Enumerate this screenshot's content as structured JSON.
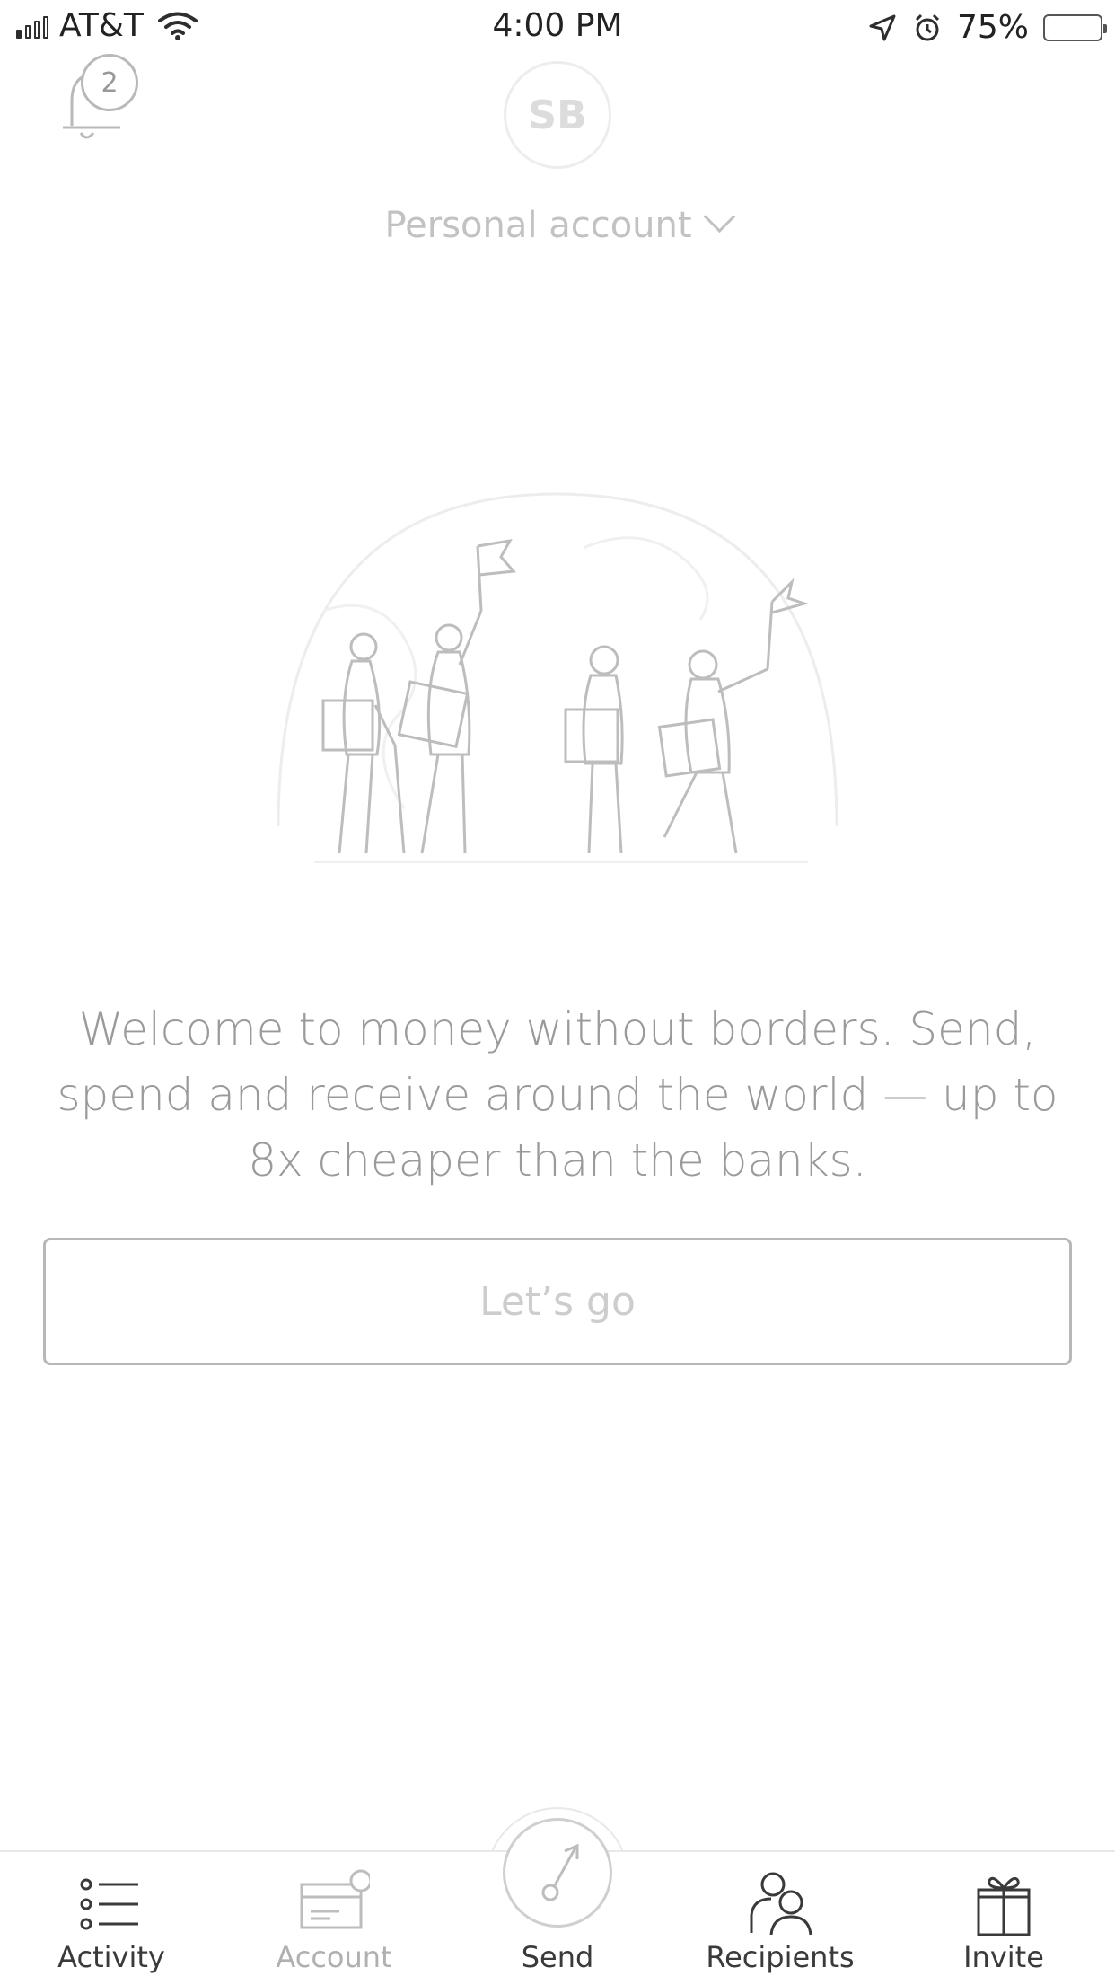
{
  "status_bar": {
    "carrier": "AT&T",
    "time": "4:00 PM",
    "battery_percent_label": "75%",
    "battery_level": 0.75
  },
  "header": {
    "notification_count": "2",
    "avatar_initials": "SB",
    "account_selector_label": "Personal account"
  },
  "welcome": {
    "message": "Welcome to money without borders. Send, spend and receive around the world — up to 8x cheaper than the banks.",
    "cta_label": "Let’s go"
  },
  "tabbar": {
    "tabs": [
      {
        "label": "Activity",
        "icon": "list-icon"
      },
      {
        "label": "Account",
        "icon": "card-icon"
      },
      {
        "label": "Send",
        "icon": "send-arrow-icon"
      },
      {
        "label": "Recipients",
        "icon": "people-icon"
      },
      {
        "label": "Invite",
        "icon": "gift-icon"
      }
    ]
  }
}
